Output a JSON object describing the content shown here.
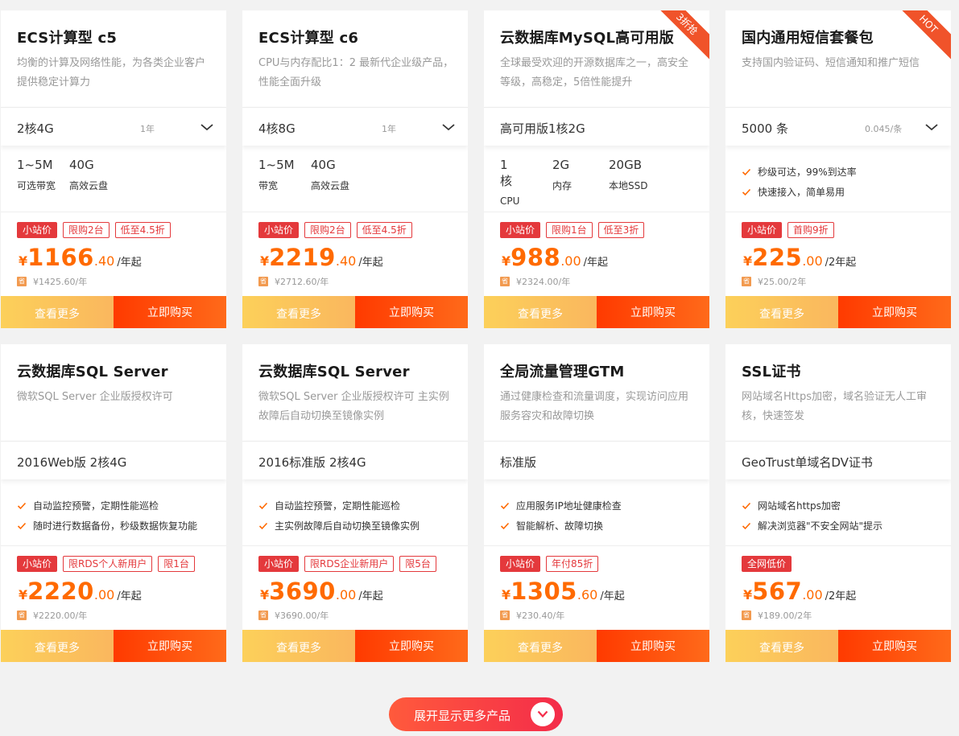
{
  "colors": {
    "accent": "#ff6a00",
    "tag_red": "#e4393c",
    "more_btn": "#fcc75c",
    "buy_btn": "#ff4a0c",
    "ribbon": "#f0532a"
  },
  "cards": [
    {
      "title": "ECS计算型 c5",
      "desc": "均衡的计算及网络性能，为各类企业客户提供稳定计算力",
      "select_value": "2核4G",
      "select_sub": "1年",
      "specs": [
        {
          "value": "1~5M",
          "label": "可选带宽"
        },
        {
          "value": "40G",
          "label": "高效云盘"
        }
      ],
      "tags": [
        "小站价",
        "限购2台",
        "低至4.5折"
      ],
      "currency": "¥",
      "price_int": "1166",
      "price_dec": ".40",
      "unit": "/年起",
      "orig_badge": "省",
      "orig": "¥1425.60/年",
      "more_label": "查看更多",
      "buy_label": "立即购买"
    },
    {
      "title": "ECS计算型 c6",
      "desc": "CPU与内存配比1：2 最新代企业级产品，性能全面升级",
      "select_value": "4核8G",
      "select_sub": "1年",
      "specs": [
        {
          "value": "1~5M",
          "label": "带宽"
        },
        {
          "value": "40G",
          "label": "高效云盘"
        }
      ],
      "tags": [
        "小站价",
        "限购2台",
        "低至4.5折"
      ],
      "currency": "¥",
      "price_int": "2219",
      "price_dec": ".40",
      "unit": "/年起",
      "orig_badge": "省",
      "orig": "¥2712.60/年",
      "more_label": "查看更多",
      "buy_label": "立即购买"
    },
    {
      "title": "云数据库MySQL高可用版",
      "desc": "全球最受欢迎的开源数据库之一，高安全等级，高稳定，5倍性能提升",
      "ribbon": "3折抢",
      "select_value": "高可用版1核2G",
      "specs": [
        {
          "value": "1核",
          "label": "CPU"
        },
        {
          "value": "2G",
          "label": "内存"
        },
        {
          "value": "20GB",
          "label": "本地SSD"
        }
      ],
      "tags": [
        "小站价",
        "限购1台",
        "低至3折"
      ],
      "currency": "¥",
      "price_int": "988",
      "price_dec": ".00",
      "unit": "/年起",
      "orig_badge": "省",
      "orig": "¥2324.00/年",
      "more_label": "查看更多",
      "buy_label": "立即购买"
    },
    {
      "title": "国内通用短信套餐包",
      "desc": "支持国内验证码、短信通知和推广短信",
      "ribbon": "HOT",
      "select_value": "5000 条",
      "select_sub": "0.045/条",
      "features": [
        "秒级可达，99%到达率",
        "快速接入，简单易用"
      ],
      "tags": [
        "小站价",
        "首购9折"
      ],
      "currency": "¥",
      "price_int": "225",
      "price_dec": ".00",
      "unit": "/2年起",
      "orig_badge": "省",
      "orig": "¥25.00/2年",
      "more_label": "查看更多",
      "buy_label": "立即购买"
    },
    {
      "title": "云数据库SQL Server",
      "desc": "微软SQL Server 企业版授权许可",
      "select_value": "2016Web版 2核4G",
      "features": [
        "自动监控预警，定期性能巡检",
        "随时进行数据备份，秒级数据恢复功能"
      ],
      "tags": [
        "小站价",
        "限RDS个人新用户",
        "限1台"
      ],
      "currency": "¥",
      "price_int": "2220",
      "price_dec": ".00",
      "unit": "/年起",
      "orig_badge": "省",
      "orig": "¥2220.00/年",
      "more_label": "查看更多",
      "buy_label": "立即购买"
    },
    {
      "title": "云数据库SQL Server",
      "desc": "微软SQL Server 企业版授权许可 主实例故障后自动切换至镜像实例",
      "select_value": "2016标准版 2核4G",
      "features": [
        "自动监控预警，定期性能巡检",
        "主实例故障后自动切换至镜像实例"
      ],
      "tags": [
        "小站价",
        "限RDS企业新用户",
        "限5台"
      ],
      "currency": "¥",
      "price_int": "3690",
      "price_dec": ".00",
      "unit": "/年起",
      "orig_badge": "省",
      "orig": "¥3690.00/年",
      "more_label": "查看更多",
      "buy_label": "立即购买"
    },
    {
      "title": "全局流量管理GTM",
      "desc": "通过健康检查和流量调度，实现访问应用服务容灾和故障切换",
      "select_value": "标准版",
      "features": [
        "应用服务IP地址健康检查",
        "智能解析、故障切换"
      ],
      "tags": [
        "小站价",
        "年付85折"
      ],
      "currency": "¥",
      "price_int": "1305",
      "price_dec": ".60",
      "unit": "/年起",
      "orig_badge": "省",
      "orig": "¥230.40/年",
      "more_label": "查看更多",
      "buy_label": "立即购买"
    },
    {
      "title": "SSL证书",
      "desc": "网站域名Https加密，域名验证无人工审核，快速签发",
      "select_value": "GeoTrust单域名DV证书",
      "features": [
        "网站域名https加密",
        "解决浏览器\"不安全网站\"提示"
      ],
      "tags": [
        "全网低价"
      ],
      "currency": "¥",
      "price_int": "567",
      "price_dec": ".00",
      "unit": "/2年起",
      "orig_badge": "省",
      "orig": "¥189.00/2年",
      "more_label": "查看更多",
      "buy_label": "立即购买"
    }
  ],
  "expand_button": {
    "label": "展开显示更多产品",
    "icon": "chevron-down-icon"
  }
}
